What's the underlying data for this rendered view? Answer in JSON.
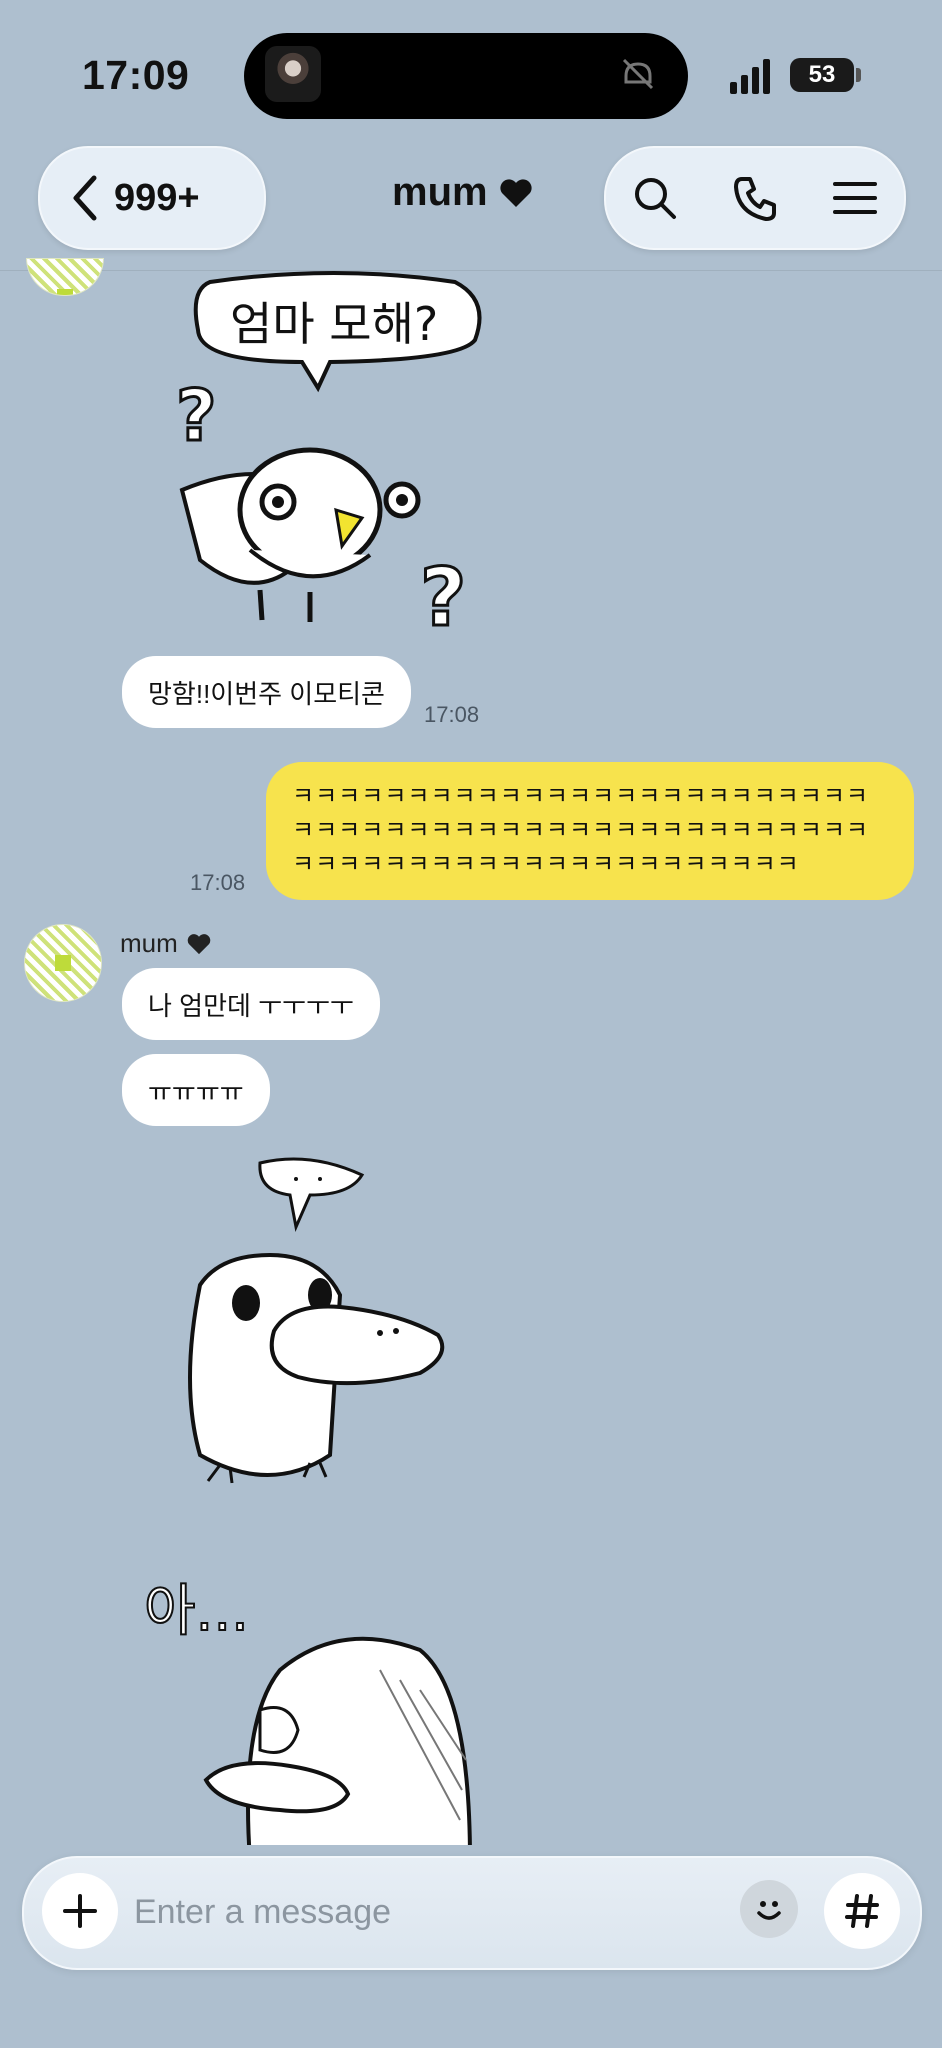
{
  "status_bar": {
    "time": "17:09",
    "battery": "53"
  },
  "header": {
    "back_count": "999+",
    "title": "mum",
    "actions": [
      "search-icon",
      "phone-icon",
      "menu-icon"
    ]
  },
  "messages": [
    {
      "type": "sticker",
      "from": "mum",
      "sticker_text": "엄마 모해?",
      "content": "question-bird-sticker"
    },
    {
      "type": "text",
      "from": "mum",
      "text": "망함!!이번주 이모티콘",
      "time": "17:08"
    },
    {
      "type": "text",
      "from": "me",
      "text": "ㅋㅋㅋㅋㅋㅋㅋㅋㅋㅋㅋㅋㅋㅋㅋㅋㅋㅋㅋㅋㅋㅋㅋㅋㅋㅋㅋㅋㅋㅋㅋㅋㅋㅋㅋㅋㅋㅋㅋㅋㅋㅋㅋㅋㅋㅋㅋㅋㅋㅋㅋㅋㅋㅋㅋㅋㅋㅋㅋㅋㅋㅋㅋㅋㅋㅋㅋㅋㅋㅋㅋㅋ",
      "time": "17:08"
    },
    {
      "type": "text",
      "from": "mum",
      "sender": "mum",
      "text": "나 엄만데 ㅜㅜㅜㅜ"
    },
    {
      "type": "text",
      "from": "mum",
      "text": "ㅠㅠㅠㅠ"
    },
    {
      "type": "sticker",
      "from": "mum",
      "content": "platypus-sticker"
    },
    {
      "type": "sticker",
      "from": "mum",
      "sticker_text": "아...",
      "content": "platypus-sigh-sticker"
    }
  ],
  "input": {
    "placeholder": "Enter a message"
  },
  "colors": {
    "background": "#aebfcf",
    "outgoing_bubble": "#f7e34d",
    "incoming_bubble": "#ffffff"
  }
}
